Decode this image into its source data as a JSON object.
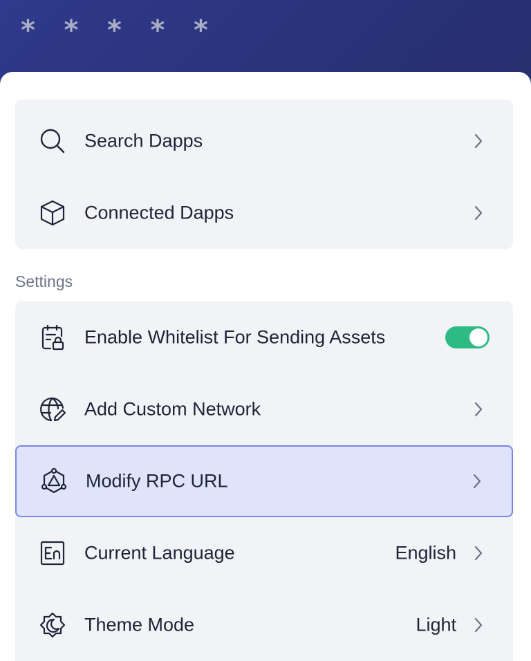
{
  "header": {
    "masked_stars": [
      "*",
      "*",
      "*",
      "*",
      "*"
    ]
  },
  "dapps": {
    "items": [
      {
        "label": "Search Dapps",
        "icon": "search-icon"
      },
      {
        "label": "Connected Dapps",
        "icon": "cube-icon"
      }
    ]
  },
  "settings": {
    "section_label": "Settings",
    "items": [
      {
        "label": "Enable Whitelist For Sending Assets",
        "icon": "calendar-lock-icon",
        "toggle_on": true
      },
      {
        "label": "Add Custom Network",
        "icon": "globe-edit-icon"
      },
      {
        "label": "Modify RPC URL",
        "icon": "network-nodes-icon",
        "selected": true
      },
      {
        "label": "Current Language",
        "value": "English",
        "icon": "language-en-icon"
      },
      {
        "label": "Theme Mode",
        "value": "Light",
        "icon": "theme-moon-icon"
      }
    ]
  },
  "colors": {
    "header_bg": "#2a3278",
    "card_bg": "#f1f3f7",
    "selected_bg": "#dfe3fb",
    "selected_border": "#7b86e3",
    "toggle_on": "#2dbb83"
  }
}
